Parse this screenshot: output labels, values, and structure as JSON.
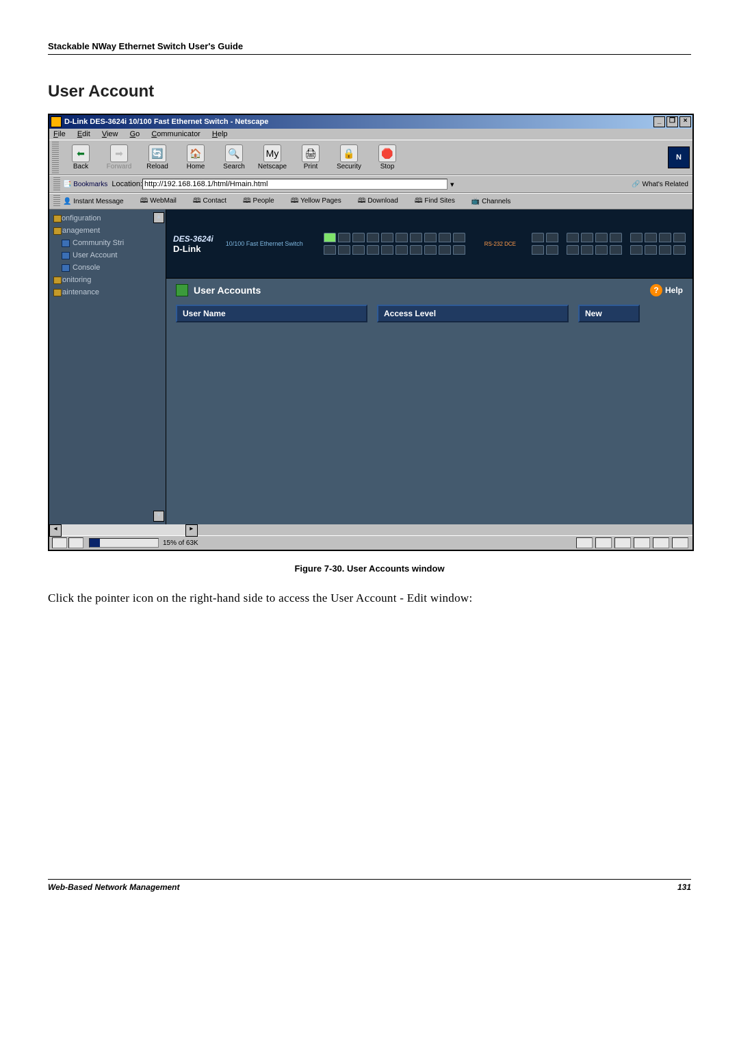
{
  "guide_header": "Stackable NWay Ethernet Switch User's Guide",
  "section_heading": "User Account",
  "browser": {
    "title": "D-Link DES-3624i 10/100 Fast Ethernet Switch - Netscape",
    "win_min": "_",
    "win_max": "❐",
    "win_close": "×",
    "menus": {
      "file": "File",
      "edit": "Edit",
      "view": "View",
      "go": "Go",
      "communicator": "Communicator",
      "help": "Help"
    },
    "buttons": {
      "back": "Back",
      "forward": "Forward",
      "reload": "Reload",
      "home": "Home",
      "search": "Search",
      "netscape": "Netscape",
      "print": "Print",
      "security": "Security",
      "stop": "Stop"
    },
    "bookmarks_label": "Bookmarks",
    "location_label": "Location:",
    "location_value": "http://192.168.168.1/html/Hmain.html",
    "whats_related": "What's Related",
    "links": {
      "instant": "Instant Message",
      "webmail": "WebMail",
      "contact": "Contact",
      "people": "People",
      "yellow": "Yellow Pages",
      "download": "Download",
      "findsites": "Find Sites",
      "channels": "Channels"
    },
    "status_pct": "15% of 63K"
  },
  "sidebar": {
    "configuration": "Configuration",
    "management": "Management",
    "community": "Community Stri",
    "user_account": "User Account",
    "console": "Console",
    "monitoring": "Monitoring",
    "maintenance": "Maintenance"
  },
  "device": {
    "model": "DES-3624i",
    "brand": "D-Link",
    "desc": "10/100 Fast Ethernet Switch",
    "rs232": "RS-232 DCE"
  },
  "panel": {
    "title": "User Accounts",
    "help": "Help",
    "col_user": "User Name",
    "col_access": "Access Level",
    "col_new": "New"
  },
  "figure_caption": "Figure 7-30.  User Accounts window",
  "body_text": "Click the pointer icon on the right-hand side to access the User Account - Edit window:",
  "footer_left": "Web-Based Network Management",
  "footer_right": "131"
}
